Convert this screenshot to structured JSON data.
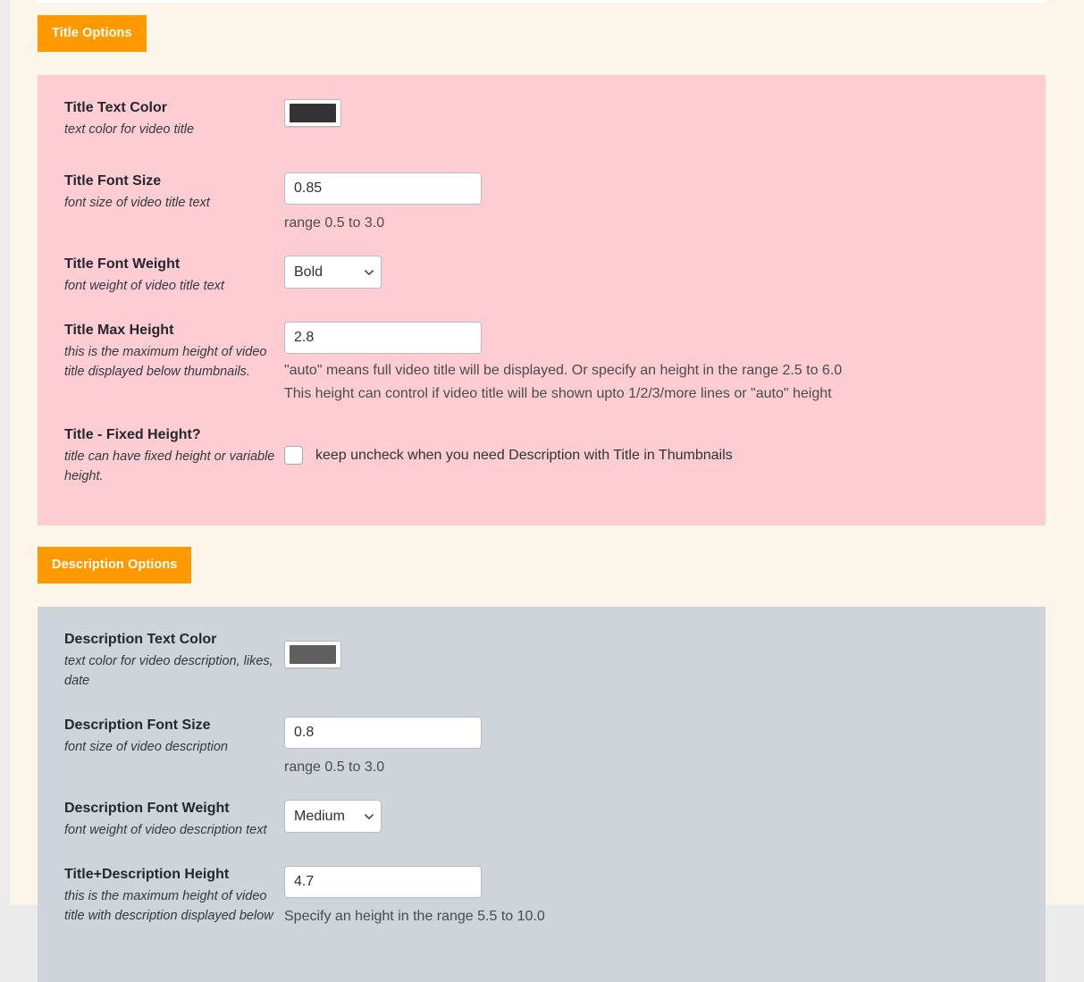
{
  "theme": {
    "page_background": "#fcf5e9",
    "gutter": "#ebebeb",
    "tab_accent": "#ff9900",
    "tab_text": "#ffffff",
    "title_panel_bg": "#fecdd3",
    "description_panel_bg": "#ced4da"
  },
  "sections": [
    {
      "tab_label": "Title Options",
      "rows": [
        {
          "label": "Title Text Color",
          "description": "text color for video title",
          "control": "color",
          "value": "#333333",
          "icon": "color-swatch"
        },
        {
          "label": "Title Font Size",
          "description": "font size of video title text",
          "control": "text",
          "value": "0.85",
          "hint": "range 0.5 to 3.0"
        },
        {
          "label": "Title Font Weight",
          "description": "font weight of video title text",
          "control": "select",
          "value": "Bold",
          "icon": "chevron-down-icon"
        },
        {
          "label": "Title Max Height",
          "description": "this is the maximum height of video title displayed below thumbnails.",
          "control": "text",
          "value": "2.8",
          "hint_line1": "\"auto\" means full video title will be displayed. Or specify an height in the range 2.5 to 6.0",
          "hint_line2": "This height can control if video title will be shown upto 1/2/3/more lines or \"auto\" height"
        },
        {
          "label": "Title - Fixed Height?",
          "description": "title can have fixed height or variable height.",
          "control": "checkbox",
          "checked": false,
          "checkbox_text": "keep uncheck when you need Description with Title in Thumbnails"
        }
      ]
    },
    {
      "tab_label": "Description Options",
      "rows": [
        {
          "label": "Description Text Color",
          "description": "text color for video description, likes, date",
          "control": "color",
          "value": "#5f5f5f",
          "icon": "color-swatch"
        },
        {
          "label": "Description Font Size",
          "description": "font size of video description",
          "control": "text",
          "value": "0.8",
          "hint": "range 0.5 to 3.0"
        },
        {
          "label": "Description Font Weight",
          "description": "font weight of video description text",
          "control": "select",
          "value": "Medium",
          "icon": "chevron-down-icon"
        },
        {
          "label": "Title+Description Height",
          "description": "this is the maximum height of video title with description displayed below",
          "control": "text",
          "value": "4.7",
          "hint": "Specify an height in the range 5.5 to 10.0"
        }
      ]
    }
  ]
}
